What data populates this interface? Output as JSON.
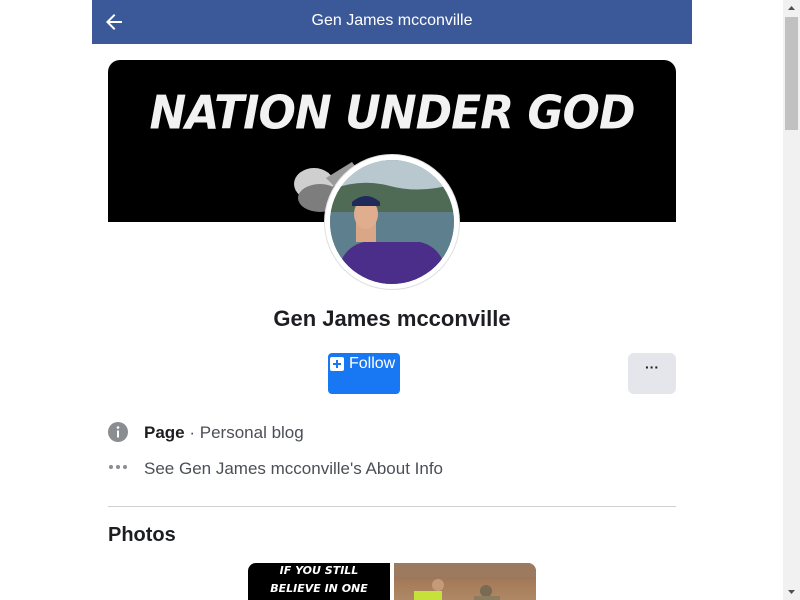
{
  "header": {
    "title": "Gen James mcconville",
    "back_icon": "arrow-left-icon"
  },
  "cover": {
    "text": "NATION UNDER GOD"
  },
  "profile": {
    "name": "Gen James mcconville"
  },
  "actions": {
    "follow_label": "Follow",
    "more_label": "···"
  },
  "info": {
    "category_label": "Page",
    "category_separator": " · ",
    "category_value": "Personal blog",
    "about_link": "See Gen James mcconville's About Info"
  },
  "photos": {
    "title": "Photos",
    "items": [
      {
        "caption_lines": [
          "IF YOU STILL",
          "BELIEVE IN ONE"
        ]
      },
      {
        "caption_lines": []
      }
    ]
  },
  "colors": {
    "header_bg": "#3b5998",
    "follow_bg": "#1877f2",
    "more_bg": "#e4e6eb"
  }
}
